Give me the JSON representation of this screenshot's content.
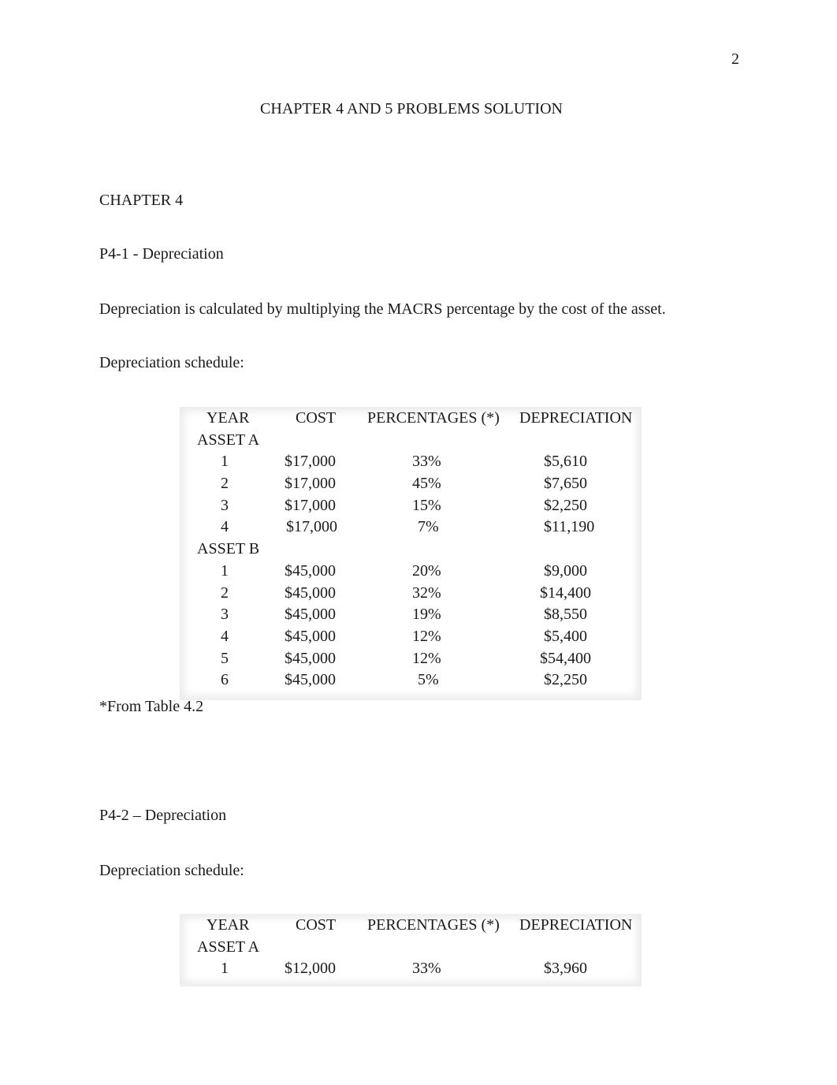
{
  "page_number": "2",
  "title": "CHAPTER 4 AND 5 PROBLEMS SOLUTION",
  "chapter_heading": "CHAPTER 4",
  "problem1": {
    "heading": "P4-1 -  Depreciation",
    "intro": "Depreciation is calculated by multiplying the MACRS percentage by the cost of the asset.",
    "schedule_label": "Depreciation schedule:",
    "table": {
      "headers": [
        "YEAR",
        "COST",
        "PERCENTAGES (*)",
        "DEPRECIATION"
      ],
      "groups": [
        {
          "label": "ASSET A",
          "rows": [
            {
              "year": "1",
              "cost": "$17,000",
              "pct": "33%",
              "dep": "$5,610"
            },
            {
              "year": "2",
              "cost": "$17,000",
              "pct": "45%",
              "dep": "$7,650"
            },
            {
              "year": "3",
              "cost": "$17,000",
              "pct": "15%",
              "dep": "$2,250"
            },
            {
              "year": "4",
              "cost": "$17,000",
              "pct": "7%",
              "dep": "$11,190"
            }
          ]
        },
        {
          "label": "ASSET B",
          "rows": [
            {
              "year": "1",
              "cost": "$45,000",
              "pct": "20%",
              "dep": "$9,000"
            },
            {
              "year": "2",
              "cost": "$45,000",
              "pct": "32%",
              "dep": "$14,400"
            },
            {
              "year": "3",
              "cost": "$45,000",
              "pct": "19%",
              "dep": "$8,550"
            },
            {
              "year": "4",
              "cost": "$45,000",
              "pct": "12%",
              "dep": "$5,400"
            },
            {
              "year": "5",
              "cost": "$45,000",
              "pct": "12%",
              "dep": "$54,400"
            },
            {
              "year": "6",
              "cost": "$45,000",
              "pct": "5%",
              "dep": "$2,250"
            }
          ]
        }
      ]
    },
    "footnote": "*From Table 4.2"
  },
  "problem2": {
    "heading": "P4-2 – Depreciation",
    "schedule_label": "Depreciation schedule:",
    "table": {
      "headers": [
        "YEAR",
        "COST",
        "PERCENTAGES (*)",
        "DEPRECIATION"
      ],
      "groups": [
        {
          "label": "ASSET A",
          "rows": [
            {
              "year": "1",
              "cost": "$12,000",
              "pct": "33%",
              "dep": "$3,960"
            }
          ]
        }
      ]
    }
  }
}
